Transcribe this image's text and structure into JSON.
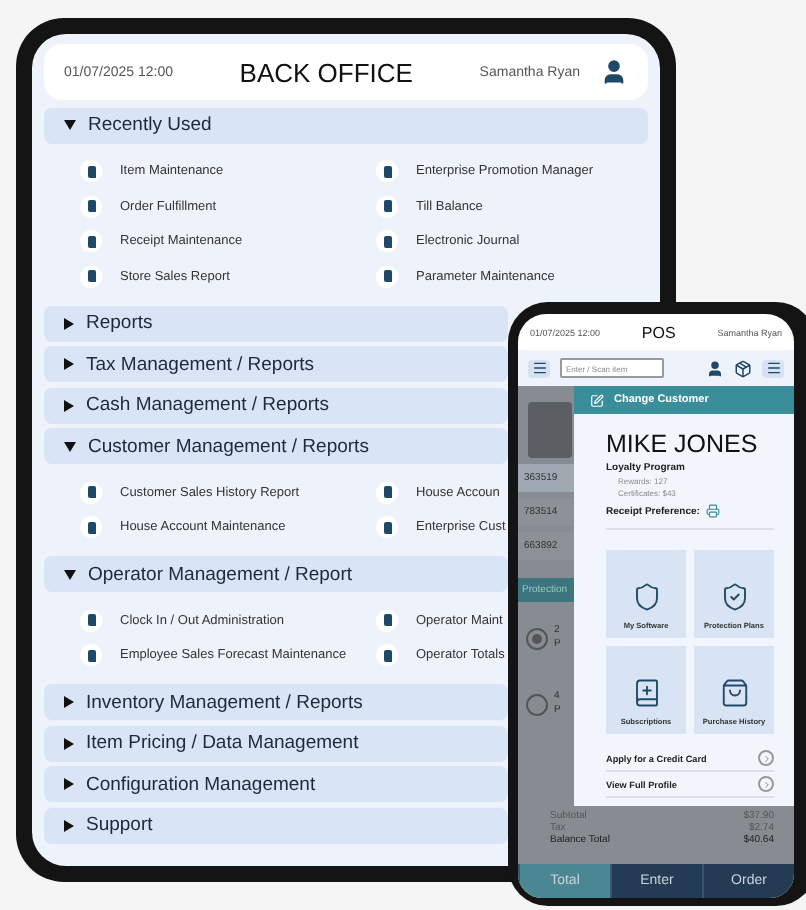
{
  "tablet": {
    "header": {
      "datetime": "01/07/2025 12:00",
      "title": "BACK OFFICE",
      "user": "Samantha Ryan"
    },
    "sections": [
      {
        "label": "Recently Used",
        "expanded": true,
        "items": [
          "Item Maintenance",
          "Enterprise Promotion Manager",
          "Order Fulfillment",
          "Till Balance",
          "Receipt Maintenance",
          "Electronic Journal",
          "Store Sales Report",
          "Parameter Maintenance"
        ]
      },
      {
        "label": "Reports",
        "expanded": false
      },
      {
        "label": "Tax Management / Reports",
        "expanded": false
      },
      {
        "label": "Cash Management / Reports",
        "expanded": false
      },
      {
        "label": "Customer Management / Reports",
        "expanded": true,
        "items": [
          "Customer Sales History Report",
          "House Accoun",
          "House Account Maintenance",
          "Enterprise Cust"
        ]
      },
      {
        "label": "Operator Management / Report",
        "expanded": true,
        "items": [
          "Clock In / Out Administration",
          "Operator Maint",
          "Employee Sales Forecast Maintenance",
          "Operator Totals"
        ]
      },
      {
        "label": "Inventory Management / Reports",
        "expanded": false
      },
      {
        "label": "Item Pricing / Data Management",
        "expanded": false
      },
      {
        "label": "Configuration Management",
        "expanded": false
      },
      {
        "label": "Support",
        "expanded": false
      }
    ]
  },
  "phone": {
    "header": {
      "datetime": "01/07/2025 12:00",
      "title": "POS",
      "user": "Samantha Ryan"
    },
    "search": {
      "placeholder": "Enter / Scan item"
    },
    "background": {
      "codes": [
        {
          "text": "363519",
          "selected": true
        },
        {
          "text": "783514",
          "selected": false
        },
        {
          "text": "663892",
          "selected": false
        }
      ],
      "tab": "Protection",
      "options": [
        {
          "lines": [
            "2",
            "P"
          ],
          "selected": true
        },
        {
          "lines": [
            "4",
            "P"
          ],
          "selected": false
        }
      ]
    },
    "customer_panel": {
      "header": "Change Customer",
      "name": "MIKE JONES",
      "program": "Loyalty Program",
      "rewards": "Rewards: 127",
      "certificates": "Certificates: $43",
      "receipt_label": "Receipt Preference:",
      "tiles": [
        {
          "kind": "software",
          "label": "My Software"
        },
        {
          "kind": "protection",
          "label": "Protection Plans"
        },
        {
          "kind": "subscriptions",
          "label": "Subscriptions"
        },
        {
          "kind": "history",
          "label": "Purchase History"
        }
      ],
      "links": [
        "Apply for a Credit Card",
        "View Full Profile"
      ]
    },
    "totals": [
      {
        "label": "Subtotal",
        "value": "$37.90"
      },
      {
        "label": "Tax",
        "value": "$2.74"
      },
      {
        "label": "Balance Total",
        "value": "$40.64"
      }
    ],
    "footer_buttons": [
      {
        "label": "Total",
        "selected": true
      },
      {
        "label": "Enter",
        "selected": false
      },
      {
        "label": "Order",
        "selected": false
      }
    ]
  }
}
